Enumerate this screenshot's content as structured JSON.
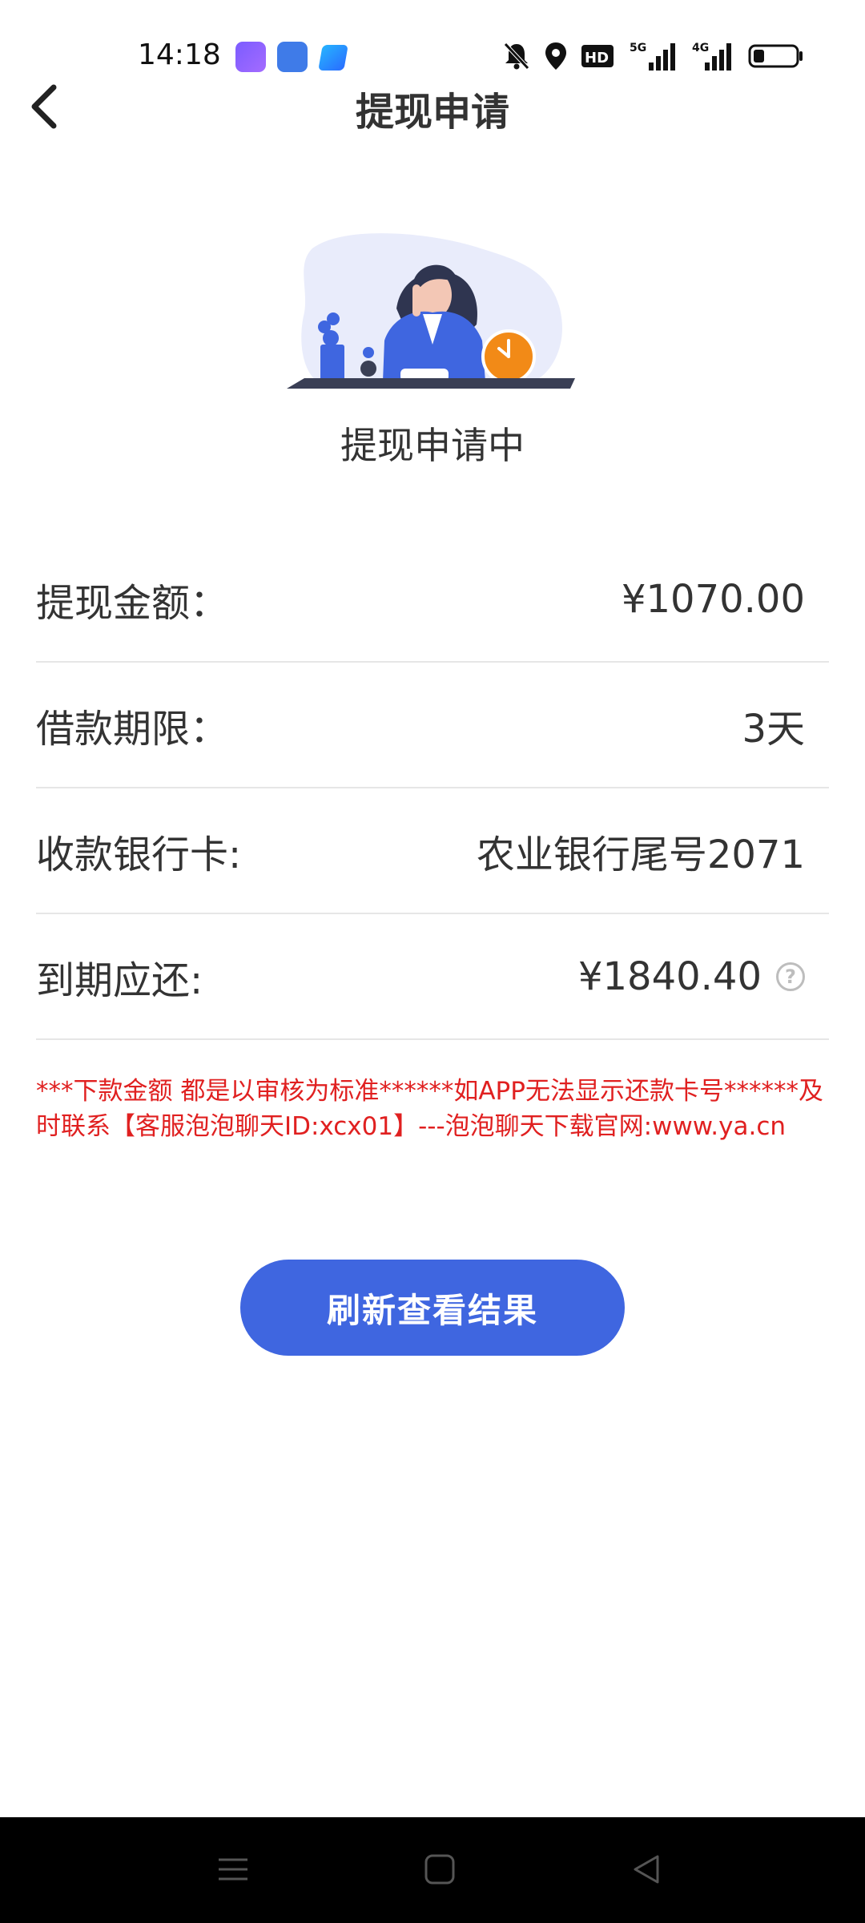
{
  "status_bar": {
    "time": "14:18",
    "battery_level": 0.25,
    "network_5g": "5G",
    "network_4g": "4G",
    "hd_label": "HD"
  },
  "nav": {
    "title": "提现申请"
  },
  "status": {
    "title": "提现申请中"
  },
  "details": {
    "rows": [
      {
        "label": "提现金额：",
        "value": "¥1070.00"
      },
      {
        "label": "借款期限：",
        "value": "3天"
      },
      {
        "label": "收款银行卡:",
        "value": "农业银行尾号2071"
      },
      {
        "label": "到期应还:",
        "value": "¥1840.40"
      }
    ]
  },
  "notice": "***下款金额 都是以审核为标准******如APP无法显示还款卡号******及时联系【客服泡泡聊天ID:xcx01】---泡泡聊天下载官网:www.ya.cn",
  "refresh_button": "刷新查看结果",
  "colors": {
    "accent": "#3f66e0",
    "notice": "#e02020",
    "divider": "#e6e6e6"
  }
}
